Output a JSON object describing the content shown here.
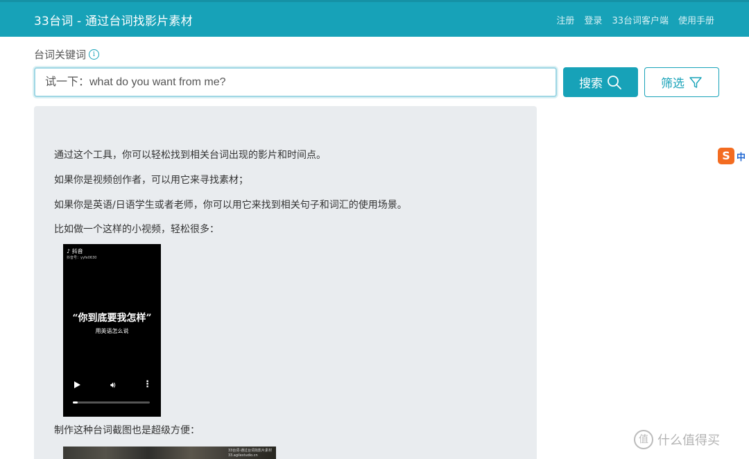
{
  "header": {
    "brand": "33台词 - 通过台词找影片素材",
    "nav": [
      "注册",
      "登录",
      "33台词客户端",
      "使用手册"
    ]
  },
  "search": {
    "label": "台词关键词",
    "info_icon": "info-icon",
    "placeholder": "试一下：what do you want from me?",
    "search_label": "搜索",
    "search_icon": "search-icon",
    "filter_label": "筛选",
    "filter_icon": "filter-icon"
  },
  "content": {
    "paragraphs": [
      "通过这个工具，你可以轻松找到相关台词出现的影片和时间点。",
      "如果你是视频创作者，可以用它来寻找素材；",
      "如果你是英语/日语学生或者老师，你可以用它来找到相关句子和词汇的使用场景。",
      "比如做一个这样的小视频，轻松很多："
    ],
    "video": {
      "app_name": "抖音",
      "account": "抖音号：yyfe0630",
      "quote": "“你到底要我怎样”",
      "subtitle": "用英语怎么说",
      "progress": 0.06
    },
    "after_video": "制作这种台词截图也是超级方便：",
    "thumbnail_caption": "33台词-通过台词找影片素材\n33.agilestudio.cn"
  },
  "overlay": {
    "ime_label": "中",
    "watermark_text": "什么值得买",
    "watermark_logo": "值"
  },
  "colors": {
    "accent": "#17a2b8",
    "panel_bg": "#e9ecef"
  }
}
